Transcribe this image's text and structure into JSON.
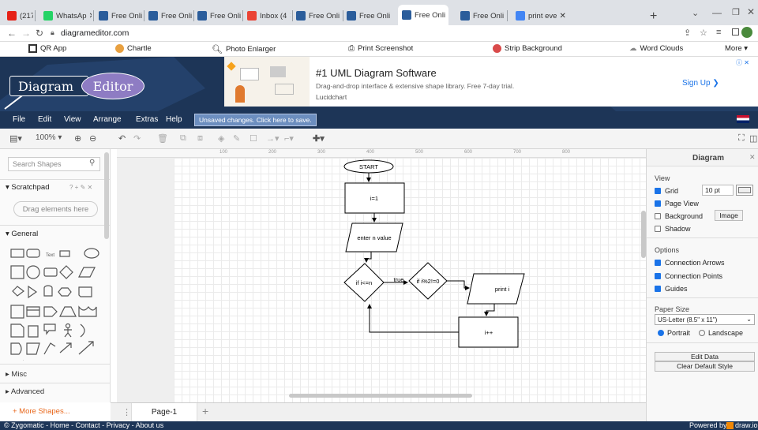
{
  "browser": {
    "tabs": [
      {
        "label": "(217)",
        "color": "#e62117"
      },
      {
        "label": "WhatsAp",
        "color": "#25d366"
      },
      {
        "label": "Free Onli",
        "color": "#2b5d9b"
      },
      {
        "label": "Free Onli",
        "color": "#2b5d9b"
      },
      {
        "label": "Free Onli",
        "color": "#2b5d9b"
      },
      {
        "label": "Inbox (4",
        "color": "#ea4335"
      },
      {
        "label": "Free Onli",
        "color": "#2b5d9b"
      },
      {
        "label": "Free Onli",
        "color": "#2b5d9b"
      },
      {
        "label": "Free Onli",
        "color": "#2b5d9b"
      },
      {
        "label": "Free Onli",
        "color": "#2b5d9b"
      },
      {
        "label": "print eve",
        "color": "#4285f4"
      }
    ],
    "new_tab": "+",
    "url": "diagrameditor.com",
    "bookmarks": [
      "QR App",
      "Chartle",
      "Photo Enlarger",
      "Print Screenshot",
      "Strip Background",
      "Word Clouds",
      "More ▾"
    ]
  },
  "banner": {
    "logo_left": "Diagram",
    "logo_right": "Editor",
    "ad_title": "#1 UML Diagram Software",
    "ad_desc": "Drag-and-drop interface & extensive shape library. Free 7-day trial.",
    "ad_brand": "Lucidchart",
    "ad_cta": "Sign Up  ❯",
    "ad_badge": "ⓘ ✕"
  },
  "menubar": {
    "items": [
      "File",
      "Edit",
      "View",
      "Arrange",
      "Extras",
      "Help"
    ],
    "unsaved": "Unsaved changes. Click here to save."
  },
  "toolbar": {
    "zoom": "100% ▾"
  },
  "left": {
    "search_placeholder": "Search Shapes",
    "scratchpad": "Scratchpad",
    "scratch_icons": "? + ✎ ✕",
    "drag_here": "Drag elements here",
    "general": "General",
    "text_shape": "Text",
    "misc": "Misc",
    "advanced": "Advanced",
    "more_shapes": "+ More Shapes..."
  },
  "ruler": [
    "100",
    "200",
    "300",
    "400",
    "500",
    "600",
    "700",
    "800"
  ],
  "flow": {
    "start": "START",
    "init": "i=1",
    "input": "enter n value",
    "cond1": "if i<=n",
    "true_label": "true",
    "cond2": "if i%2!=0",
    "print": "print i",
    "incr": "i++"
  },
  "right": {
    "title": "Diagram",
    "close": "✕",
    "view": "View",
    "grid": "Grid",
    "grid_size": "10 pt",
    "page_view": "Page View",
    "background": "Background",
    "image_btn": "Image",
    "shadow": "Shadow",
    "options": "Options",
    "conn_arrows": "Connection Arrows",
    "conn_points": "Connection Points",
    "guides": "Guides",
    "paper_size": "Paper Size",
    "paper_value": "US-Letter (8.5\" x 11\")",
    "portrait": "Portrait",
    "landscape": "Landscape",
    "edit_data": "Edit Data",
    "clear_style": "Clear Default Style"
  },
  "pagetab": "Page-1",
  "footer": {
    "links": "© Zygomatic - Home - Contact - Privacy - About us",
    "powered": "Powered by",
    "drawio": "draw.io"
  }
}
